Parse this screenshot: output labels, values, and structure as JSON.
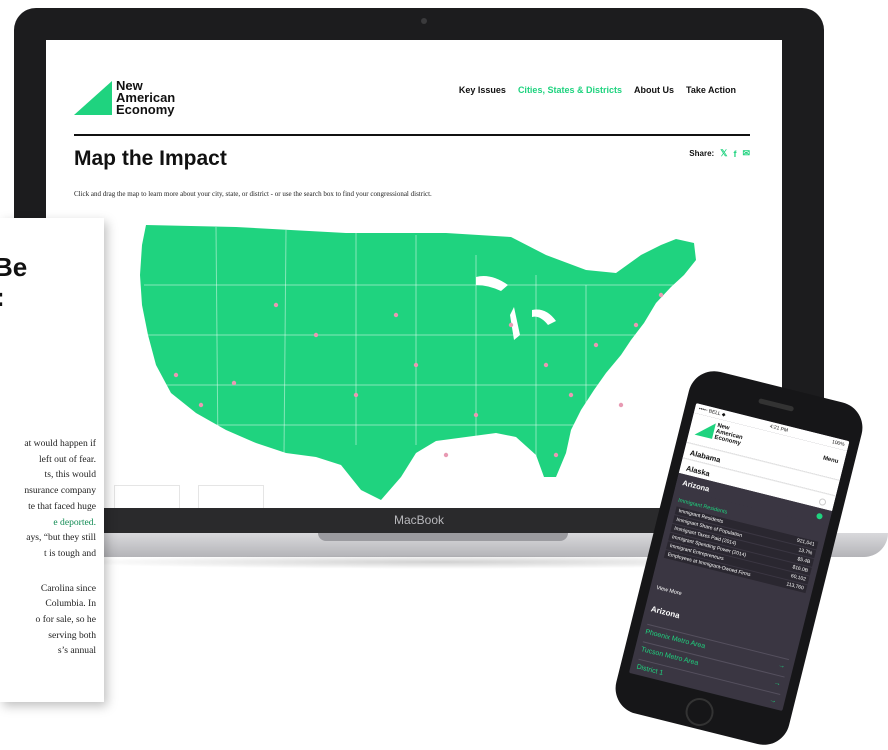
{
  "laptop": {
    "brand": "MacBook",
    "site": {
      "logo_lines": [
        "New",
        "American",
        "Economy"
      ],
      "nav": [
        "Key Issues",
        "Cities, States & Districts",
        "About Us",
        "Take Action"
      ],
      "active_nav": 1,
      "page_title": "Map the Impact",
      "share_label": "Share:",
      "share_icons": [
        "twitter-icon",
        "facebook-icon",
        "email-icon"
      ],
      "intro": "Click and drag the map to learn more about your city, state, or district - or use the search box to find your congressional district.",
      "map_fill": "#1fd37f",
      "accent": "#1fd37f"
    }
  },
  "article": {
    "headline_fragments": [
      "Be",
      ":"
    ],
    "lines": [
      "at would happen if",
      "left out of fear.",
      "ts, this would",
      "nsurance company",
      "te that faced huge",
      "e deported.",
      "ays, “but they still",
      "t is tough and",
      "",
      " Carolina since",
      "Columbia. In",
      "o for sale, so he",
      "serving both",
      "s’s annual"
    ]
  },
  "phone": {
    "status_left": "••••◦ BELL ◆",
    "status_time": "4:21 PM",
    "status_right": "100%",
    "logo_lines": [
      "New",
      "American",
      "Economy"
    ],
    "menu_label": "Menu",
    "states": [
      "Alabama",
      "Alaska"
    ],
    "active_state": "Arizona",
    "stats_heading": "Immigrant Residents",
    "stats": [
      {
        "label": "Immigrant Residents",
        "value": "921,041"
      },
      {
        "label": "Immigrant Share of Population",
        "value": "13.7%"
      },
      {
        "label": "Immigrant Taxes Paid (2014)",
        "value": "$5.4B"
      },
      {
        "label": "Immigrant Spending Power (2014)",
        "value": "$16.0B"
      },
      {
        "label": "Immigrant Entrepreneurs",
        "value": "60,102"
      },
      {
        "label": "Employees at Immigrant-Owned Firms",
        "value": "113,760"
      }
    ],
    "view_more": "View More",
    "section": "Arizona",
    "links": [
      "Phoenix Metro Area",
      "Tucson Metro Area",
      "District 1"
    ]
  }
}
